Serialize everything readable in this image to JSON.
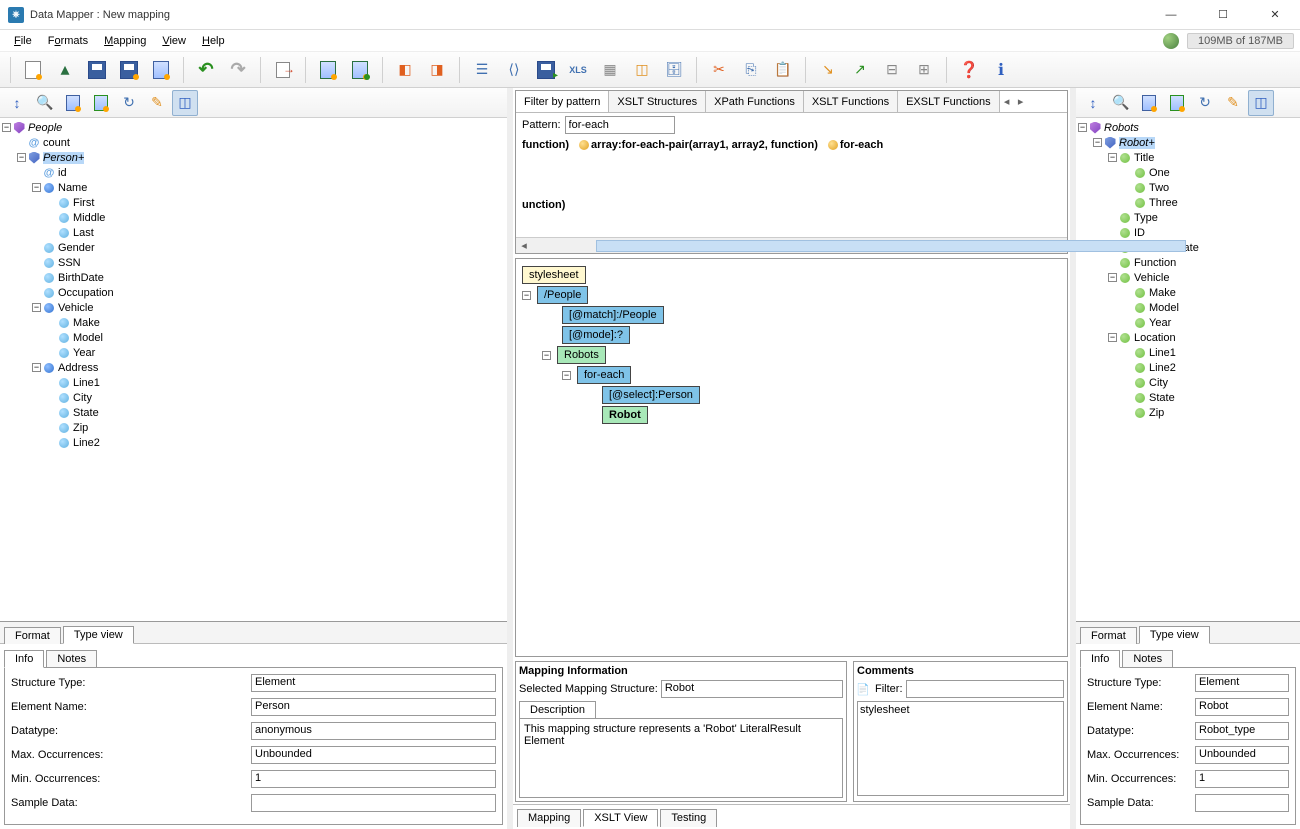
{
  "window": {
    "title": "Data Mapper : New mapping"
  },
  "menu": {
    "file": "File",
    "formats": "Formats",
    "mapping": "Mapping",
    "view": "View",
    "help": "Help"
  },
  "memory": "109MB of 187MB",
  "leftTree": {
    "root": "People",
    "count": "count",
    "person": "Person+",
    "id": "id",
    "name": "Name",
    "first": "First",
    "middle": "Middle",
    "last": "Last",
    "gender": "Gender",
    "ssn": "SSN",
    "birth": "BirthDate",
    "occ": "Occupation",
    "vehicle": "Vehicle",
    "make": "Make",
    "model": "Model",
    "year": "Year",
    "address": "Address",
    "line1": "Line1",
    "city": "City",
    "state": "State",
    "zip": "Zip",
    "line2": "Line2"
  },
  "leftBottomTabs": {
    "format": "Format",
    "typeview": "Type view"
  },
  "infoTabs": {
    "info": "Info",
    "notes": "Notes"
  },
  "leftInfo": {
    "stLbl": "Structure Type:",
    "st": "Element",
    "enLbl": "Element Name:",
    "en": "Person",
    "dtLbl": "Datatype:",
    "dt": "anonymous",
    "maxLbl": "Max. Occurrences:",
    "max": "Unbounded",
    "minLbl": "Min. Occurrences:",
    "min": "1",
    "sdLbl": "Sample Data:",
    "sd": ""
  },
  "filterTabs": {
    "t0": "Filter by pattern",
    "t1": "XSLT Structures",
    "t2": "XPath Functions",
    "t3": "XSLT Functions",
    "t4": "EXSLT Functions"
  },
  "pattern": {
    "label": "Pattern:",
    "value": "for-each"
  },
  "funcs": {
    "f1": "function)",
    "f2": "array:for-each-pair(array1, array2, function)",
    "f3": "for-each",
    "f4": "unction)"
  },
  "mapNodes": {
    "stylesheet": "stylesheet",
    "people": "/People",
    "match": "[@match]:/People",
    "mode": "[@mode]:?",
    "robots": "Robots",
    "foreach": "for-each",
    "select": "[@select]:Person",
    "robot": "Robot"
  },
  "mapInfo": {
    "title": "Mapping Information",
    "selLbl": "Selected Mapping Structure:",
    "sel": "Robot",
    "descTab": "Description",
    "desc": "This mapping structure represents a 'Robot' LiteralResult Element"
  },
  "comments": {
    "title": "Comments",
    "filterLbl": "Filter:",
    "item": "stylesheet"
  },
  "centerTabs": {
    "mapping": "Mapping",
    "xslt": "XSLT View",
    "testing": "Testing"
  },
  "rightTree": {
    "root": "Robots",
    "robot": "Robot+",
    "title": "Title",
    "one": "One",
    "two": "Two",
    "three": "Three",
    "type": "Type",
    "id": "ID",
    "cd": "CreationDate",
    "fn": "Function",
    "vehicle": "Vehicle",
    "make": "Make",
    "model": "Model",
    "year": "Year",
    "location": "Location",
    "line1": "Line1",
    "line2": "Line2",
    "city": "City",
    "state": "State",
    "zip": "Zip"
  },
  "rightInfo": {
    "stLbl": "Structure Type:",
    "st": "Element",
    "enLbl": "Element Name:",
    "en": "Robot",
    "dtLbl": "Datatype:",
    "dt": "Robot_type",
    "maxLbl": "Max. Occurrences:",
    "max": "Unbounded",
    "minLbl": "Min. Occurrences:",
    "min": "1",
    "sdLbl": "Sample Data:",
    "sd": ""
  }
}
